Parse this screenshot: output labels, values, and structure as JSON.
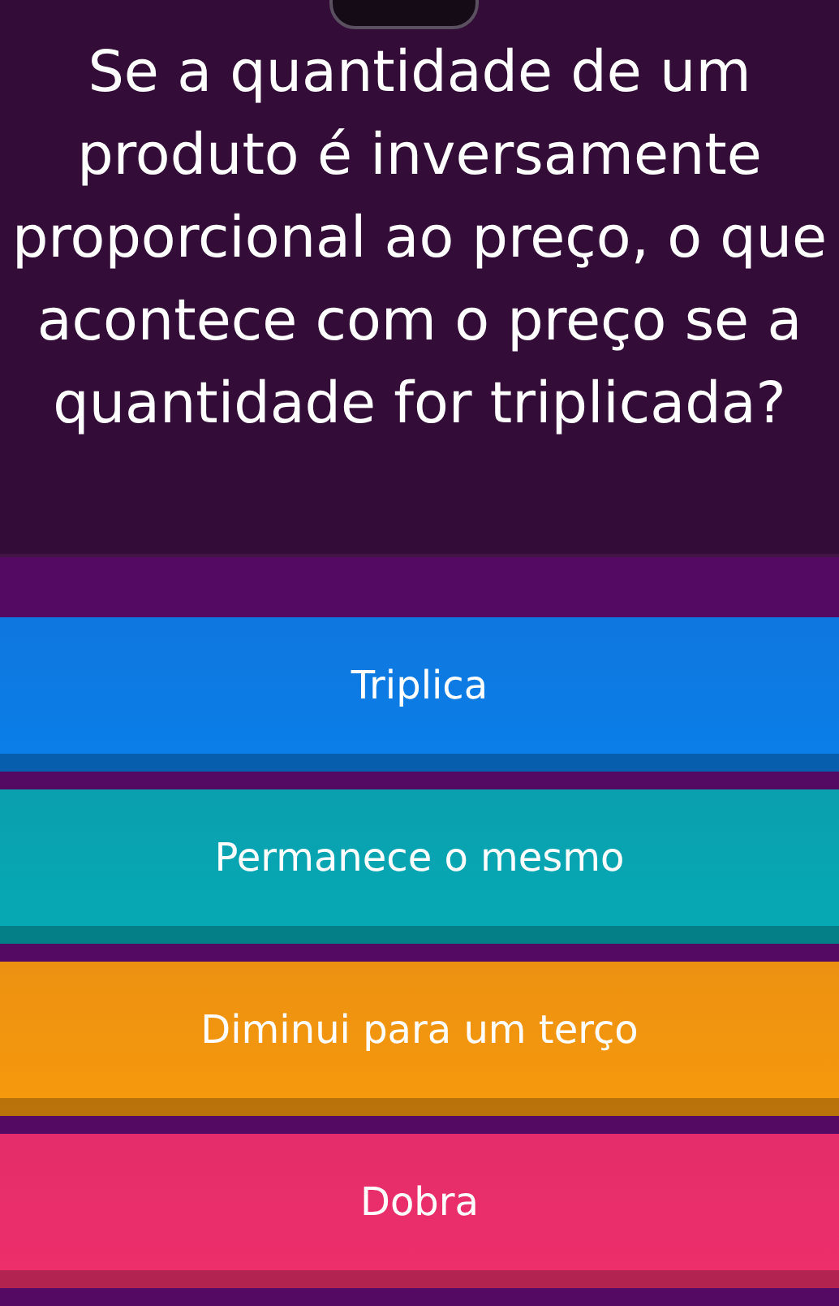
{
  "question": {
    "text": "Se a quantidade de um produto é inversamente proporcional ao preço, o que acontece com o preço se a quantidade for triplicada?"
  },
  "answers": [
    {
      "label": "Triplica",
      "color": "#0a7fe8"
    },
    {
      "label": "Permanece o mesmo",
      "color": "#05aab5"
    },
    {
      "label": "Diminui para um terço",
      "color": "#f79a0c"
    },
    {
      "label": "Dobra",
      "color": "#ee2f6b"
    }
  ]
}
